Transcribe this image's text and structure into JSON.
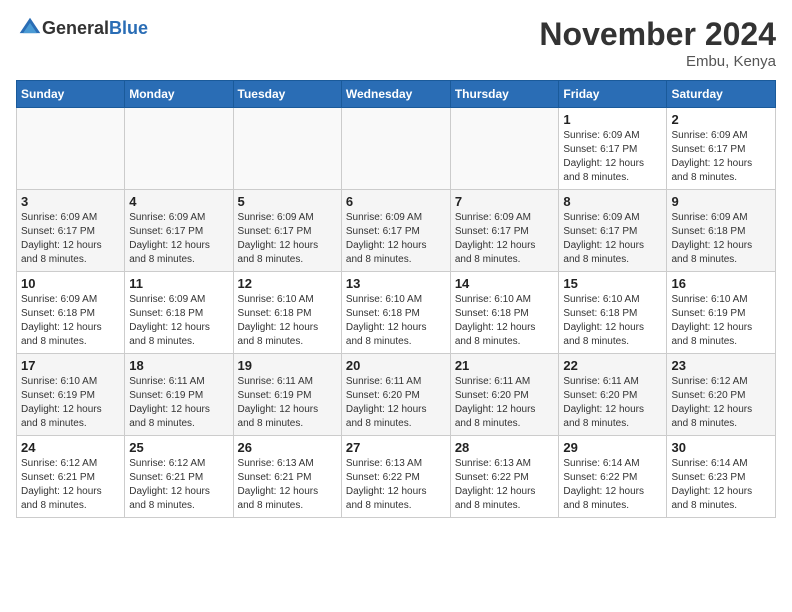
{
  "header": {
    "logo_general": "General",
    "logo_blue": "Blue",
    "month_title": "November 2024",
    "location": "Embu, Kenya"
  },
  "days_of_week": [
    "Sunday",
    "Monday",
    "Tuesday",
    "Wednesday",
    "Thursday",
    "Friday",
    "Saturday"
  ],
  "weeks": [
    [
      {
        "day": "",
        "info": ""
      },
      {
        "day": "",
        "info": ""
      },
      {
        "day": "",
        "info": ""
      },
      {
        "day": "",
        "info": ""
      },
      {
        "day": "",
        "info": ""
      },
      {
        "day": "1",
        "info": "Sunrise: 6:09 AM\nSunset: 6:17 PM\nDaylight: 12 hours and 8 minutes."
      },
      {
        "day": "2",
        "info": "Sunrise: 6:09 AM\nSunset: 6:17 PM\nDaylight: 12 hours and 8 minutes."
      }
    ],
    [
      {
        "day": "3",
        "info": "Sunrise: 6:09 AM\nSunset: 6:17 PM\nDaylight: 12 hours and 8 minutes."
      },
      {
        "day": "4",
        "info": "Sunrise: 6:09 AM\nSunset: 6:17 PM\nDaylight: 12 hours and 8 minutes."
      },
      {
        "day": "5",
        "info": "Sunrise: 6:09 AM\nSunset: 6:17 PM\nDaylight: 12 hours and 8 minutes."
      },
      {
        "day": "6",
        "info": "Sunrise: 6:09 AM\nSunset: 6:17 PM\nDaylight: 12 hours and 8 minutes."
      },
      {
        "day": "7",
        "info": "Sunrise: 6:09 AM\nSunset: 6:17 PM\nDaylight: 12 hours and 8 minutes."
      },
      {
        "day": "8",
        "info": "Sunrise: 6:09 AM\nSunset: 6:17 PM\nDaylight: 12 hours and 8 minutes."
      },
      {
        "day": "9",
        "info": "Sunrise: 6:09 AM\nSunset: 6:18 PM\nDaylight: 12 hours and 8 minutes."
      }
    ],
    [
      {
        "day": "10",
        "info": "Sunrise: 6:09 AM\nSunset: 6:18 PM\nDaylight: 12 hours and 8 minutes."
      },
      {
        "day": "11",
        "info": "Sunrise: 6:09 AM\nSunset: 6:18 PM\nDaylight: 12 hours and 8 minutes."
      },
      {
        "day": "12",
        "info": "Sunrise: 6:10 AM\nSunset: 6:18 PM\nDaylight: 12 hours and 8 minutes."
      },
      {
        "day": "13",
        "info": "Sunrise: 6:10 AM\nSunset: 6:18 PM\nDaylight: 12 hours and 8 minutes."
      },
      {
        "day": "14",
        "info": "Sunrise: 6:10 AM\nSunset: 6:18 PM\nDaylight: 12 hours and 8 minutes."
      },
      {
        "day": "15",
        "info": "Sunrise: 6:10 AM\nSunset: 6:18 PM\nDaylight: 12 hours and 8 minutes."
      },
      {
        "day": "16",
        "info": "Sunrise: 6:10 AM\nSunset: 6:19 PM\nDaylight: 12 hours and 8 minutes."
      }
    ],
    [
      {
        "day": "17",
        "info": "Sunrise: 6:10 AM\nSunset: 6:19 PM\nDaylight: 12 hours and 8 minutes."
      },
      {
        "day": "18",
        "info": "Sunrise: 6:11 AM\nSunset: 6:19 PM\nDaylight: 12 hours and 8 minutes."
      },
      {
        "day": "19",
        "info": "Sunrise: 6:11 AM\nSunset: 6:19 PM\nDaylight: 12 hours and 8 minutes."
      },
      {
        "day": "20",
        "info": "Sunrise: 6:11 AM\nSunset: 6:20 PM\nDaylight: 12 hours and 8 minutes."
      },
      {
        "day": "21",
        "info": "Sunrise: 6:11 AM\nSunset: 6:20 PM\nDaylight: 12 hours and 8 minutes."
      },
      {
        "day": "22",
        "info": "Sunrise: 6:11 AM\nSunset: 6:20 PM\nDaylight: 12 hours and 8 minutes."
      },
      {
        "day": "23",
        "info": "Sunrise: 6:12 AM\nSunset: 6:20 PM\nDaylight: 12 hours and 8 minutes."
      }
    ],
    [
      {
        "day": "24",
        "info": "Sunrise: 6:12 AM\nSunset: 6:21 PM\nDaylight: 12 hours and 8 minutes."
      },
      {
        "day": "25",
        "info": "Sunrise: 6:12 AM\nSunset: 6:21 PM\nDaylight: 12 hours and 8 minutes."
      },
      {
        "day": "26",
        "info": "Sunrise: 6:13 AM\nSunset: 6:21 PM\nDaylight: 12 hours and 8 minutes."
      },
      {
        "day": "27",
        "info": "Sunrise: 6:13 AM\nSunset: 6:22 PM\nDaylight: 12 hours and 8 minutes."
      },
      {
        "day": "28",
        "info": "Sunrise: 6:13 AM\nSunset: 6:22 PM\nDaylight: 12 hours and 8 minutes."
      },
      {
        "day": "29",
        "info": "Sunrise: 6:14 AM\nSunset: 6:22 PM\nDaylight: 12 hours and 8 minutes."
      },
      {
        "day": "30",
        "info": "Sunrise: 6:14 AM\nSunset: 6:23 PM\nDaylight: 12 hours and 8 minutes."
      }
    ]
  ]
}
